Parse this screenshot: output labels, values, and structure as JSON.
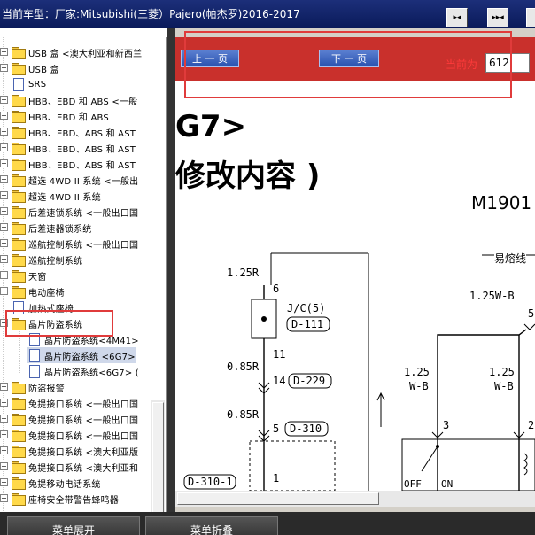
{
  "title": "当前车型：厂家:Mitsubishi(三菱）Pajero(帕杰罗)2016-2017",
  "toolbar": {
    "btn1_icon": "fit-page-icon",
    "btn2_icon": "fit-width-icon"
  },
  "tree": {
    "items": [
      {
        "label": "USB 盒 <澳大利亚和新西兰",
        "type": "folder",
        "expand": true
      },
      {
        "label": "USB 盒",
        "type": "folder",
        "expand": true
      },
      {
        "label": "SRS",
        "type": "doc",
        "expand": false
      },
      {
        "label": "HBB、EBD 和 ABS <一般",
        "type": "folder",
        "expand": true
      },
      {
        "label": "HBB、EBD 和 ABS",
        "type": "folder",
        "expand": true
      },
      {
        "label": "HBB、EBD、ABS 和 AST",
        "type": "folder",
        "expand": true
      },
      {
        "label": "HBB、EBD、ABS 和 AST",
        "type": "folder",
        "expand": true
      },
      {
        "label": "HBB、EBD、ABS 和 AST",
        "type": "folder",
        "expand": true
      },
      {
        "label": "超选 4WD II 系统 <一般出",
        "type": "folder",
        "expand": true
      },
      {
        "label": "超选 4WD II 系统",
        "type": "folder",
        "expand": true
      },
      {
        "label": "后差速锁系统 <一般出口国",
        "type": "folder",
        "expand": true
      },
      {
        "label": "后差速器锁系统",
        "type": "folder",
        "expand": true
      },
      {
        "label": "巡航控制系统 <一般出口国",
        "type": "folder",
        "expand": true
      },
      {
        "label": "巡航控制系统",
        "type": "folder",
        "expand": true
      },
      {
        "label": "天窗",
        "type": "folder",
        "expand": true
      },
      {
        "label": "电动座椅",
        "type": "folder",
        "expand": true
      },
      {
        "label": "加热式座椅",
        "type": "doc",
        "expand": false
      },
      {
        "label": "晶片防盗系统",
        "type": "folder",
        "expand": true
      },
      {
        "label": "晶片防盗系统<4M41>",
        "type": "doc",
        "expand": false
      },
      {
        "label": "晶片防盗系统 <6G7>",
        "type": "doc",
        "expand": false
      },
      {
        "label": "晶片防盗系统<6G7> (",
        "type": "doc",
        "expand": false
      },
      {
        "label": "防盗报警",
        "type": "folder",
        "expand": true
      },
      {
        "label": "免提接口系统 <一般出口国",
        "type": "folder",
        "expand": true
      },
      {
        "label": "免提接口系统 <一般出口国",
        "type": "folder",
        "expand": true
      },
      {
        "label": "免提接口系统 <一般出口国",
        "type": "folder",
        "expand": true
      },
      {
        "label": "免提接口系统 <澳大利亚版",
        "type": "folder",
        "expand": true
      },
      {
        "label": "免提接口系统 <澳大利亚和",
        "type": "folder",
        "expand": true
      },
      {
        "label": "免提移动电话系统",
        "type": "folder",
        "expand": true
      },
      {
        "label": "座椅安全带警告蜂鸣器",
        "type": "folder",
        "expand": true
      }
    ]
  },
  "nav": {
    "prev_label": "上 一 页",
    "next_label": "下 一 页",
    "current_label": "当前为",
    "current_page": "612"
  },
  "diagram": {
    "header_big": "G7>",
    "header_sub": "修改内容 )",
    "code": "M1901",
    "fuse_label": "易熔线",
    "wires": {
      "w1": "1.25R",
      "w2": "0.85R",
      "w3": "0.85R",
      "w4": "1.25W-B",
      "w5a": "1.25",
      "w5b": "W-B",
      "w6a": "1.25",
      "w6b": "W-B"
    },
    "pins": {
      "p6": "6",
      "p11": "11",
      "p14": "14",
      "p5": "5",
      "p1": "1",
      "p3": "3",
      "p2": "2",
      "p5b": "5"
    },
    "connectors": {
      "jc": "J/C(5)",
      "d111": "D-111",
      "d229": "D-229",
      "d310": "D-310",
      "d3101": "D-310-1"
    },
    "switch": {
      "off": "OFF",
      "on": "ON"
    }
  },
  "bottom": {
    "expand_label": "菜单展开",
    "collapse_label": "菜单折叠"
  }
}
